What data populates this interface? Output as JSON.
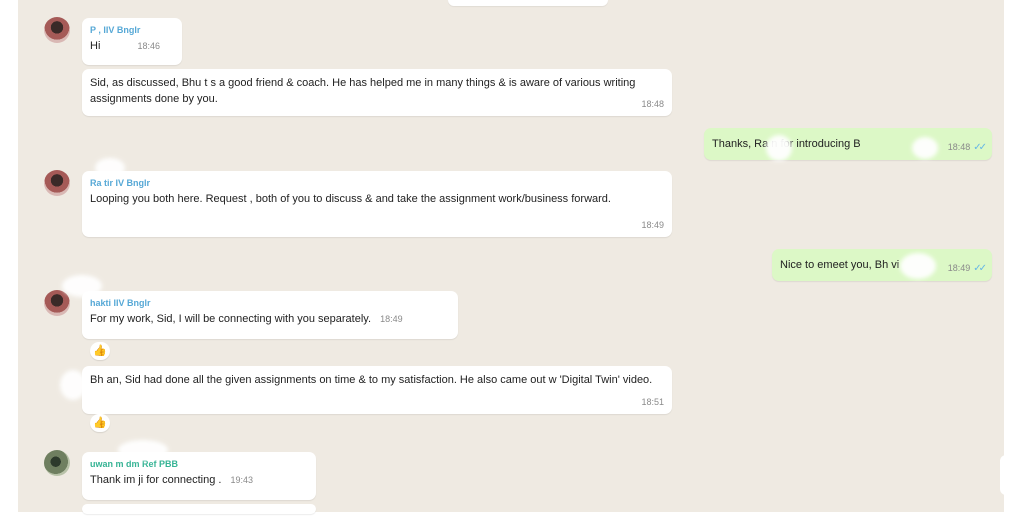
{
  "messages": [
    {
      "sender": "P   , IIV Bnglr",
      "text": "Hi",
      "time": "18:46",
      "sender_color": "#56a8d6"
    },
    {
      "text": "Sid, as discussed, Bhu   t  s a good friend & coach. He has helped me in many things & is aware of various writing assignments done by you.",
      "time": "18:48"
    },
    {
      "outgoing": true,
      "text": "Thanks, Ra    n for introducing B",
      "time": "18:48"
    },
    {
      "sender": "Ra tir    IV Bnglr",
      "text": "Looping you both here. Request , both of you to discuss & and take the assignment work/business forward.",
      "time": "18:49",
      "sender_color": "#56a8d6"
    },
    {
      "outgoing": true,
      "text": "Nice to emeet you, Bh  vi",
      "time": "18:49"
    },
    {
      "sender": "hakti   IIV Bnglr",
      "text": "For my work, Sid, I will be connecting with you separately.",
      "time": "18:49",
      "reaction": "👍",
      "sender_color": "#56a8d6"
    },
    {
      "text": "Bh    an, Sid had done all the given assignments on time & to my satisfaction. He also came out w    'Digital Twin' video.",
      "time": "18:51",
      "reaction": "👍"
    },
    {
      "sender": "uwan    m   dm Ref PBB",
      "text": "Thank    im ji for connecting .",
      "time": "19:43",
      "sender_color": "#35b394"
    }
  ],
  "icons": {
    "read_receipt": "double-check-icon",
    "reaction": "thumbs-up-emoji"
  }
}
